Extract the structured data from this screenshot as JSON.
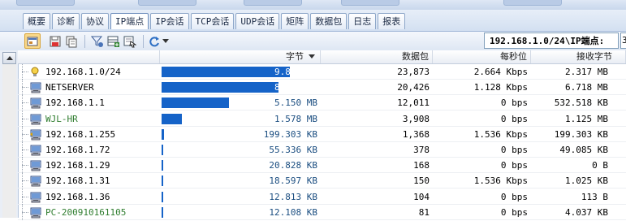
{
  "tabs": [
    {
      "label": "概要"
    },
    {
      "label": "诊断"
    },
    {
      "label": "协议"
    },
    {
      "label": "IP端点",
      "active": true
    },
    {
      "label": "IP会话"
    },
    {
      "label": "TCP会话"
    },
    {
      "label": "UDP会话"
    },
    {
      "label": "矩阵"
    },
    {
      "label": "数据包"
    },
    {
      "label": "日志"
    },
    {
      "label": "报表"
    }
  ],
  "toolbar": {
    "path": "192.168.1.0/24\\IP端点:",
    "path_extra": "3",
    "icons": [
      "view-icon",
      "save-icon",
      "copy-icon",
      "filter-icon",
      "add-column-icon",
      "locate-icon",
      "refresh-icon",
      "dropdown-arrow-icon"
    ]
  },
  "columns": {
    "bytes": "字节",
    "packets": "数据包",
    "bps": "每秒位",
    "recv_bytes": "接收字节"
  },
  "colors": {
    "bar": "#1563c8",
    "green_text": "#2f7d2f"
  },
  "rows": [
    {
      "name": "192.168.1.0/24",
      "icon": "lightbulb-icon",
      "bytes": "9.820 MB",
      "fraction": 1.0,
      "packets": "23,873",
      "bps": "2.664 Kbps",
      "recv": "2.317 MB"
    },
    {
      "name": "NETSERVER",
      "icon": "computer-icon",
      "bytes": "8.965 MB",
      "fraction": 0.913,
      "packets": "20,426",
      "bps": "1.128 Kbps",
      "recv": "6.718 MB"
    },
    {
      "name": "192.168.1.1",
      "icon": "computer-icon",
      "bytes": "5.150 MB",
      "fraction": 0.524,
      "packets": "12,011",
      "bps": "0 bps",
      "recv": "532.518 KB"
    },
    {
      "name": "WJL-HR",
      "icon": "computer-icon",
      "bytes": "1.578 MB",
      "fraction": 0.161,
      "packets": "3,908",
      "bps": "0 bps",
      "recv": "1.125 MB",
      "green": true
    },
    {
      "name": "192.168.1.255",
      "icon": "broadcast-computer-icon",
      "bytes": "199.303 KB",
      "fraction": 0.0198,
      "packets": "1,368",
      "bps": "1.536 Kbps",
      "recv": "199.303 KB"
    },
    {
      "name": "192.168.1.72",
      "icon": "computer-icon",
      "bytes": "55.336 KB",
      "fraction": 0.0055,
      "packets": "378",
      "bps": "0 bps",
      "recv": "49.085 KB"
    },
    {
      "name": "192.168.1.29",
      "icon": "computer-icon",
      "bytes": "20.828 KB",
      "fraction": 0.002,
      "packets": "168",
      "bps": "0 bps",
      "recv": "0 B"
    },
    {
      "name": "192.168.1.31",
      "icon": "computer-icon",
      "bytes": "18.597 KB",
      "fraction": 0.0018,
      "packets": "150",
      "bps": "1.536 Kbps",
      "recv": "1.025 KB"
    },
    {
      "name": "192.168.1.36",
      "icon": "computer-icon",
      "bytes": "12.813 KB",
      "fraction": 0.0013,
      "packets": "104",
      "bps": "0 bps",
      "recv": "113 B"
    },
    {
      "name": "PC-200910161105",
      "icon": "computer-icon",
      "bytes": "12.108 KB",
      "fraction": 0.0012,
      "packets": "81",
      "bps": "0 bps",
      "recv": "4.037 KB",
      "green": true
    }
  ]
}
